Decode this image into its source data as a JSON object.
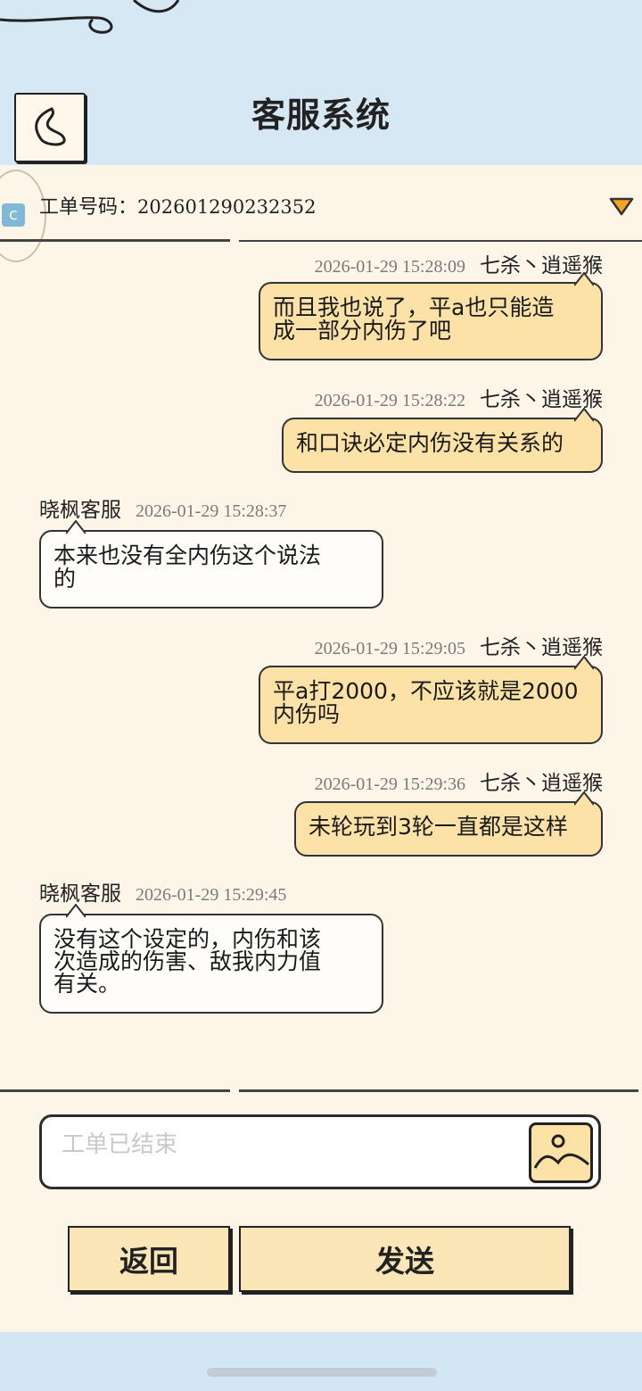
{
  "header": {
    "title": "客服系统"
  },
  "ticket": {
    "label": "工单号码：",
    "number": "202601290232352"
  },
  "messages": [
    {
      "side": "me",
      "time": "2026-01-29 15:28:09",
      "name": "七杀丶逍遥猴",
      "lines": [
        "而且我也说了，平a也只能造",
        "成一部分内伤了吧"
      ]
    },
    {
      "side": "me",
      "time": "2026-01-29 15:28:22",
      "name": "七杀丶逍遥猴",
      "lines": [
        "和口诀必定内伤没有关系的"
      ]
    },
    {
      "side": "cs",
      "time": "2026-01-29 15:28:37",
      "name": "晓枫客服",
      "lines": [
        "本来也没有全内伤这个说法",
        "的"
      ]
    },
    {
      "side": "me",
      "time": "2026-01-29 15:29:05",
      "name": "七杀丶逍遥猴",
      "lines": [
        "平a打2000，不应该就是2000",
        "内伤吗"
      ]
    },
    {
      "side": "me",
      "time": "2026-01-29 15:29:36",
      "name": "七杀丶逍遥猴",
      "lines": [
        "未轮玩到3轮一直都是这样"
      ]
    },
    {
      "side": "cs",
      "time": "2026-01-29 15:29:45",
      "name": "晓枫客服",
      "lines": [
        "没有这个设定的，内伤和该",
        "次造成的伤害、敌我内力值",
        "有关。"
      ]
    }
  ],
  "input": {
    "placeholder": "工单已结束"
  },
  "buttons": {
    "back": "返回",
    "send": "发送"
  },
  "colors": {
    "my_bubble": "#fde2a7",
    "cs_bubble": "#fffdfa",
    "panel": "#fdf5e7",
    "sky": "#d6e8f3"
  }
}
